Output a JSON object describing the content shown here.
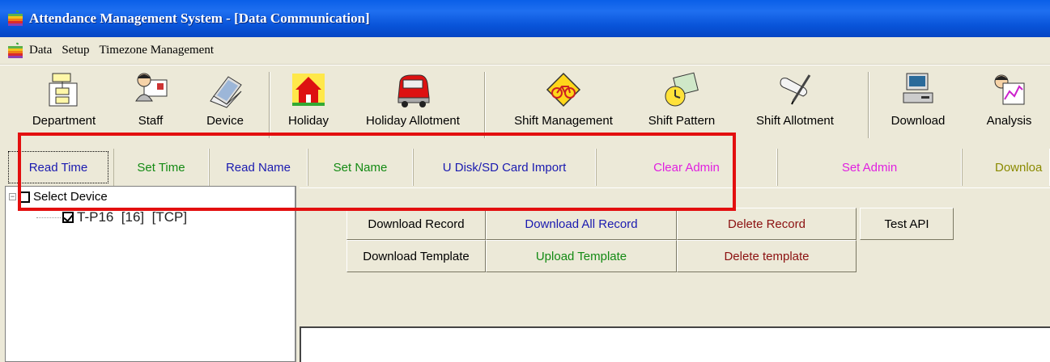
{
  "window": {
    "title": "Attendance Management System - [Data Communication]",
    "app_icon": "apple-icon"
  },
  "menu": {
    "icon": "apple-icon",
    "items": [
      "Data",
      "Setup",
      "Timezone Management"
    ]
  },
  "toolbar": {
    "items": [
      {
        "label": "Department",
        "icon": "department-tree-icon"
      },
      {
        "label": "Staff",
        "icon": "staff-id-card-icon"
      },
      {
        "label": "Device",
        "icon": "device-laptop-icon"
      },
      {
        "label": "Holiday",
        "icon": "holiday-house-icon"
      },
      {
        "label": "Holiday Allotment",
        "icon": "car-icon"
      },
      {
        "label": "Shift Management",
        "icon": "bicycle-sign-icon"
      },
      {
        "label": "Shift Pattern",
        "icon": "clock-pattern-icon"
      },
      {
        "label": "Shift Allotment",
        "icon": "scroll-pen-icon"
      },
      {
        "label": "Download",
        "icon": "computer-download-icon"
      },
      {
        "label": "Analysis",
        "icon": "analysis-chart-icon"
      }
    ]
  },
  "functions": [
    {
      "label": "Read Time",
      "color": "#1a1ab0"
    },
    {
      "label": "Set Time",
      "color": "#138a13"
    },
    {
      "label": "Read Name",
      "color": "#1a1ab0"
    },
    {
      "label": "Set Name",
      "color": "#138a13"
    },
    {
      "label": "U Disk/SD Card Import",
      "color": "#1a1ab0"
    },
    {
      "label": "Clear Admin",
      "color": "#e020e0"
    },
    {
      "label": "Set Admin",
      "color": "#e020e0"
    },
    {
      "label": "Downloa",
      "color": "#8a8a00"
    }
  ],
  "tree": {
    "root_label": "Select Device",
    "device_label": "T-P16  [16]  [TCP]"
  },
  "actions": [
    {
      "label": "Download Record",
      "color": "#000000"
    },
    {
      "label": "Download All Record",
      "color": "#1a1ab0"
    },
    {
      "label": "Delete Record",
      "color": "#8b1010"
    },
    {
      "label": "Test API",
      "color": "#000000"
    },
    {
      "label": "Download Template",
      "color": "#000000"
    },
    {
      "label": "Upload Template",
      "color": "#138a13"
    },
    {
      "label": "Delete template",
      "color": "#8b1010"
    }
  ],
  "highlight_color": "#e30f0f"
}
